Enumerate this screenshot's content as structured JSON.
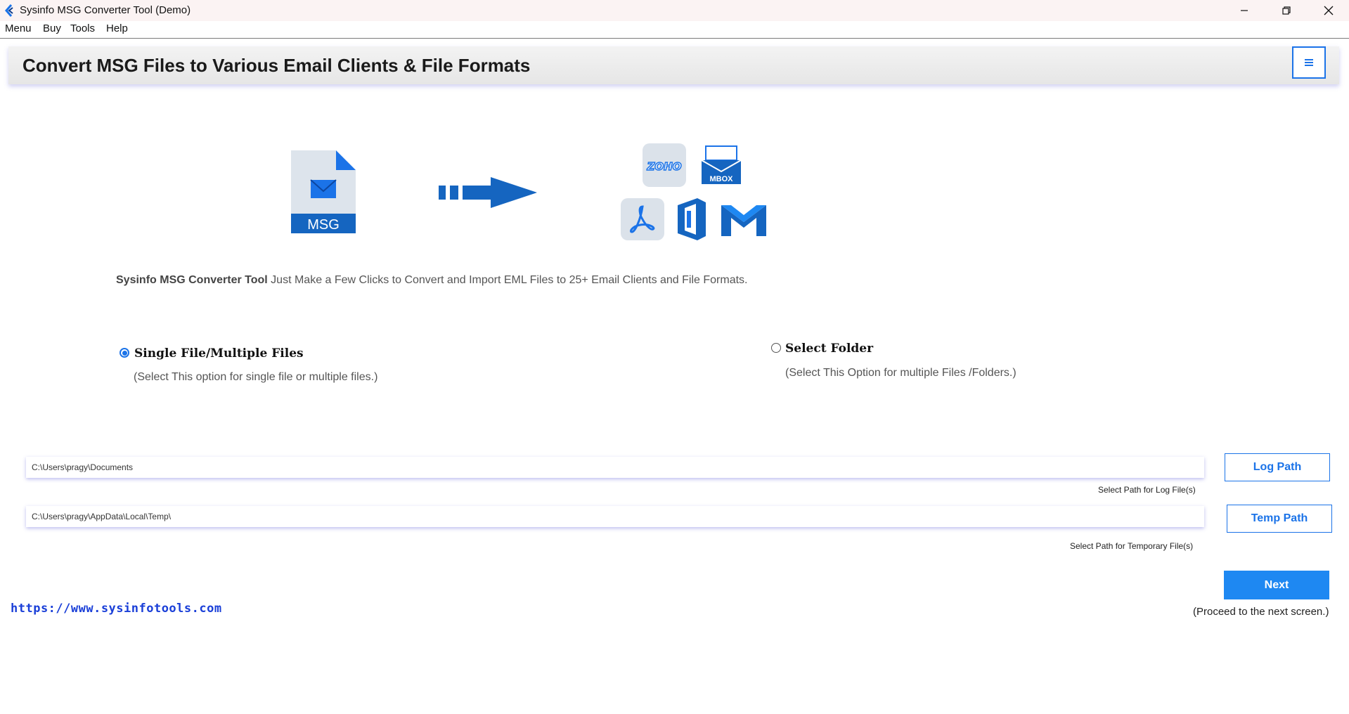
{
  "window": {
    "title": "Sysinfo MSG Converter Tool (Demo)"
  },
  "menu": [
    "Menu",
    "Buy",
    "Tools",
    "Help"
  ],
  "header": {
    "title": "Convert MSG Files to Various Email Clients & File Formats"
  },
  "graphic": {
    "msg_label": "MSG",
    "zoho_label": "ZOHO",
    "mbox_label": "MBOX"
  },
  "description": {
    "brand": "Sysinfo MSG Converter Tool",
    "text": " Just Make a Few Clicks to Convert and Import EML Files to 25+ Email Clients and File Formats."
  },
  "options": {
    "single": {
      "label": "Single File/Multiple Files",
      "sub": "(Select This option for single file or multiple files.)",
      "selected": true
    },
    "folder": {
      "label": "Select Folder",
      "sub": "(Select This Option for multiple Files /Folders.)",
      "selected": false
    }
  },
  "paths": {
    "log": {
      "value": "C:\\Users\\pragy\\Documents",
      "button": "Log Path",
      "hint": "Select Path for Log File(s)"
    },
    "temp": {
      "value": "C:\\Users\\pragy\\AppData\\Local\\Temp\\",
      "button": "Temp Path",
      "hint": "Select Path for Temporary File(s)"
    }
  },
  "next": {
    "label": "Next",
    "hint": "(Proceed to the next screen.)"
  },
  "footer": {
    "link": "https://www.sysinfotools.com"
  },
  "colors": {
    "accent": "#1b73e8",
    "next_button": "#1e88f2",
    "link": "#1a3fd8"
  }
}
